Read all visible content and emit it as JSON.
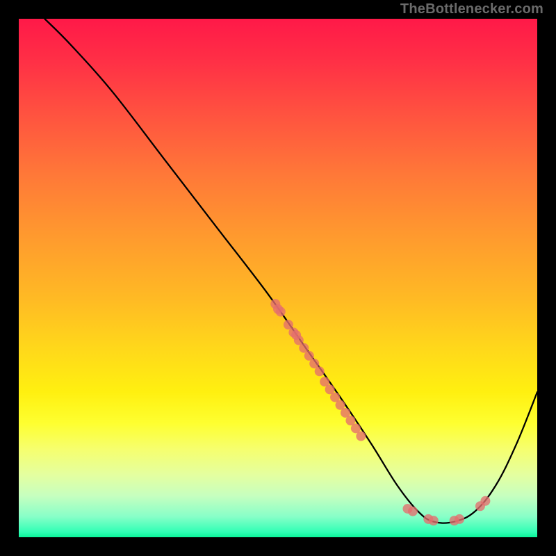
{
  "attribution": "TheBottlenecker.com",
  "chart_data": {
    "type": "line",
    "title": "",
    "xlabel": "",
    "ylabel": "",
    "xlim": [
      0,
      100
    ],
    "ylim": [
      0,
      100
    ],
    "grid": false,
    "legend": false,
    "background": "rainbow-vertical-gradient (red top to green bottom)",
    "curve": {
      "description": "Smooth bottleneck curve: starts at top-left, descends to a wide minimum around x≈80, then rises toward the right edge.",
      "points_xy": [
        [
          5,
          100
        ],
        [
          10,
          95
        ],
        [
          18,
          86
        ],
        [
          28,
          73
        ],
        [
          38,
          60
        ],
        [
          48,
          47
        ],
        [
          55,
          37
        ],
        [
          62,
          27
        ],
        [
          68,
          18
        ],
        [
          73,
          10
        ],
        [
          77,
          5
        ],
        [
          80,
          3
        ],
        [
          84,
          3
        ],
        [
          88,
          5
        ],
        [
          92,
          10
        ],
        [
          96,
          18
        ],
        [
          100,
          28
        ]
      ]
    },
    "scatter": {
      "description": "Salmon semi-transparent dots lying on or near the curve, concentrated on the descending mid-segment and near the minimum.",
      "color": "#e46e6e",
      "points_xy": [
        [
          49.5,
          45.0
        ],
        [
          50.0,
          44.0
        ],
        [
          50.5,
          43.5
        ],
        [
          52.0,
          41.0
        ],
        [
          53.0,
          39.5
        ],
        [
          53.5,
          39.0
        ],
        [
          54.0,
          38.0
        ],
        [
          55.0,
          36.5
        ],
        [
          56.0,
          35.0
        ],
        [
          57.0,
          33.5
        ],
        [
          58.0,
          32.0
        ],
        [
          59.0,
          30.0
        ],
        [
          60.0,
          28.5
        ],
        [
          61.0,
          27.0
        ],
        [
          62.0,
          25.5
        ],
        [
          63.0,
          24.0
        ],
        [
          64.0,
          22.5
        ],
        [
          65.0,
          21.0
        ],
        [
          66.0,
          19.5
        ],
        [
          75.0,
          5.5
        ],
        [
          76.0,
          5.0
        ],
        [
          79.0,
          3.5
        ],
        [
          80.0,
          3.2
        ],
        [
          84.0,
          3.2
        ],
        [
          85.0,
          3.5
        ],
        [
          89.0,
          6.0
        ],
        [
          90.0,
          7.0
        ]
      ]
    }
  }
}
